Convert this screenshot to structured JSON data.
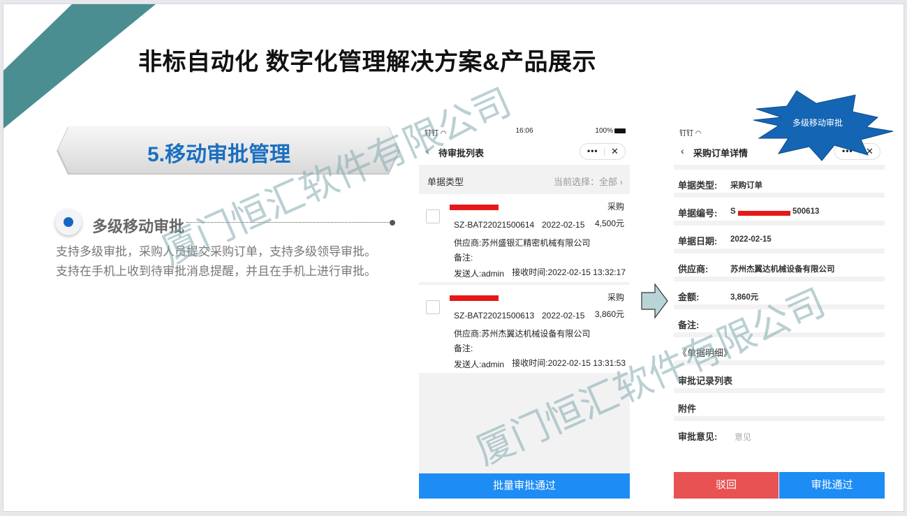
{
  "title": "非标自动化 数字化管理解决方案&产品展示",
  "section_tag": "5.移动审批管理",
  "bullet": {
    "title": "多级移动审批",
    "desc_lines": [
      "支持多级审批，采购人员提交采购订单，支持多级领导审批。",
      "支持在手机上收到待审批消息提醒，并且在手机上进行审批。"
    ]
  },
  "watermark": "厦门恒汇软件有限公司",
  "colors": {
    "accent_teal": "#4a8e92",
    "brand_blue": "#1a6fc1",
    "primary_button": "#1e8cf5",
    "reject_button": "#e85252"
  },
  "phone_list": {
    "status": {
      "carrier": "钉钉",
      "time": "16:06",
      "battery": "100%"
    },
    "nav_title": "待审批列表",
    "capsule": {
      "more": "•••",
      "close": "✕"
    },
    "filter": {
      "label": "单据类型",
      "current": "当前选择：全部"
    },
    "cards": [
      {
        "type": "采购",
        "code": "SZ-BAT22021500614",
        "date": "2022-02-15",
        "amount": "4,500元",
        "supplier": "供应商:苏州盛银汇精密机械有限公司",
        "remark": "备注:",
        "sender": "发送人:admin",
        "received": "接收时间:2022-02-15 13:32:17"
      },
      {
        "type": "采购",
        "code": "SZ-BAT22021500613",
        "date": "2022-02-15",
        "amount": "3,860元",
        "supplier": "供应商:苏州杰翼达机械设备有限公司",
        "remark": "备注:",
        "sender": "发送人:admin",
        "received": "接收时间:2022-02-15 13:31:53"
      }
    ],
    "batch_button": "批量审批通过"
  },
  "phone_detail": {
    "status": {
      "carrier": "钉钉"
    },
    "nav_title": "采购订单详情",
    "capsule": {
      "more": "•••",
      "close": "✕"
    },
    "badge": "多级移动审批",
    "fields": {
      "doc_type": {
        "label": "单据类型:",
        "value": "采购订单"
      },
      "doc_no": {
        "label": "单据编号:",
        "prefix": "S",
        "suffix": "500613"
      },
      "doc_date": {
        "label": "单据日期:",
        "value": "2022-02-15"
      },
      "supplier": {
        "label": "供应商:",
        "value": "苏州杰翼达机械设备有限公司"
      },
      "amount": {
        "label": "金额:",
        "value": "3,860元"
      },
      "remark": {
        "label": "备注:"
      },
      "details": {
        "label": "《单据明细》"
      },
      "records": {
        "label": "审批记录列表"
      },
      "attach": {
        "label": "附件"
      },
      "opinion": {
        "label": "审批意见:",
        "placeholder": "意见"
      }
    },
    "reject_button": "驳回",
    "approve_button": "审批通过"
  }
}
